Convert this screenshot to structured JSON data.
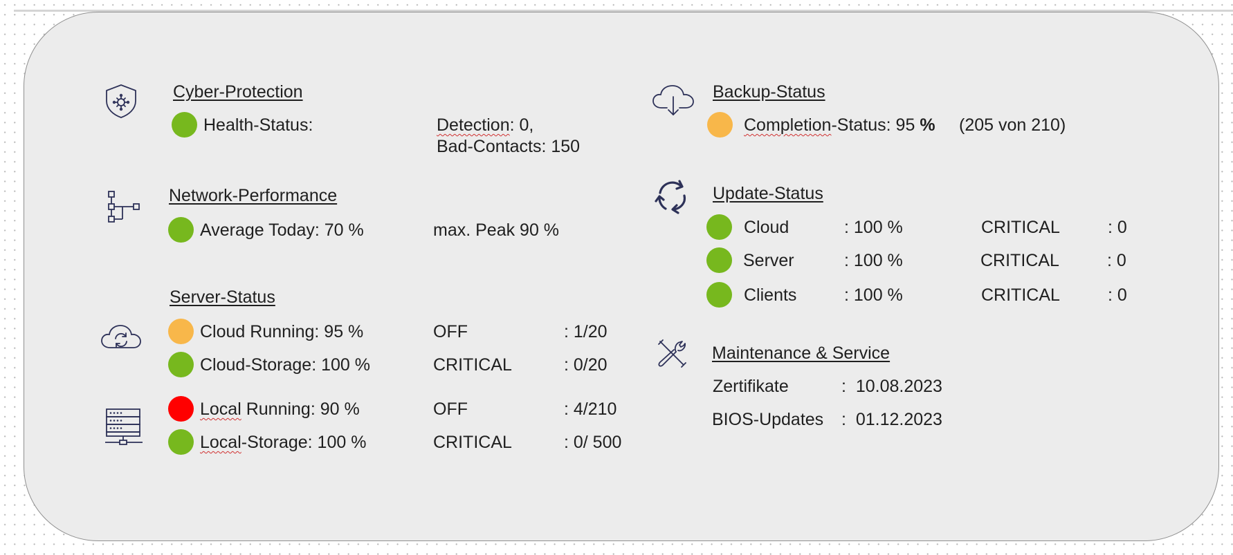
{
  "colors": {
    "ok": "#77b81e",
    "warn": "#f8b74a",
    "error": "#ff0000",
    "icon": "#2d3158",
    "panel": "#ececec"
  },
  "cyber": {
    "icon": "shield-virus-icon",
    "title": "Cyber-Protection",
    "health_label": "Health-Status:",
    "detection_label": "Detection",
    "detection_value": ": 0,",
    "bad_contacts_label": "Bad-Contacts",
    "bad_contacts_value": ": 150"
  },
  "network": {
    "icon": "network-tree-icon",
    "title": "Network-Performance",
    "average": "Average Today: 70 %",
    "peak": "max. Peak 90 %"
  },
  "server": {
    "cloud_icon": "cloud-sync-icon",
    "server_icon": "server-rack-icon",
    "title": "Server-Status",
    "rows": [
      {
        "status": "warn",
        "label": "Cloud Running: 95 %",
        "state": "OFF",
        "value": ": 1/20"
      },
      {
        "status": "ok",
        "label": "Cloud-Storage: 100 %",
        "state": "CRITICAL",
        "value": ": 0/20"
      },
      {
        "status": "error",
        "label_pre": "Local",
        "label_post": " Running: 90 %",
        "state": "OFF",
        "value": ": 4/210"
      },
      {
        "status": "ok",
        "label_pre": "Local",
        "label_post": "-Storage: 100 %",
        "state": "CRITICAL",
        "value": ": 0/ 500"
      }
    ]
  },
  "backup": {
    "icon": "cloud-download-icon",
    "title": "Backup-Status",
    "completion_label": "Completion",
    "completion_text": "-Status: 95 ",
    "percent_sign": "%",
    "count": "(205 von 210)",
    "completion_percent": 95
  },
  "update": {
    "icon": "refresh-icon",
    "title": "Update-Status",
    "rows": [
      {
        "status": "ok",
        "name": "Cloud",
        "value": ": 100 %",
        "critical_label": "CRITICAL",
        "critical_value": ": 0"
      },
      {
        "status": "ok",
        "name": "Server",
        "value": ": 100 %",
        "critical_label": "CRITICAL",
        "critical_value": ": 0"
      },
      {
        "status": "ok",
        "name": "Clients",
        "value": ": 100 %",
        "critical_label": "CRITICAL",
        "critical_value": ": 0"
      }
    ]
  },
  "maintenance": {
    "icon": "tools-icon",
    "title": "Maintenance & Service",
    "rows": [
      {
        "label": "Zertifikate",
        "value": ":  10.08.2023"
      },
      {
        "label": "BIOS-Updates",
        "value": ":  01.12.2023"
      }
    ]
  }
}
